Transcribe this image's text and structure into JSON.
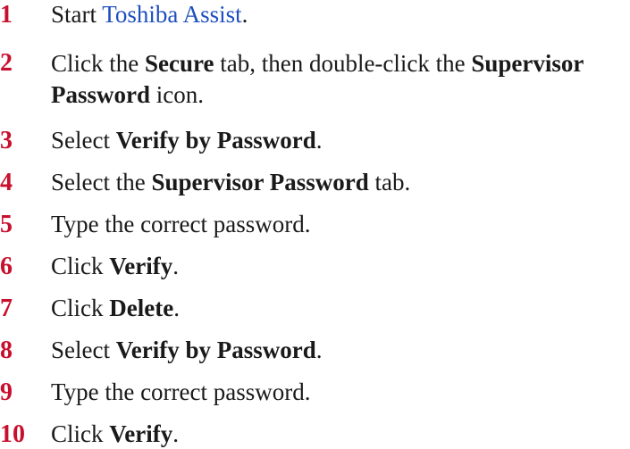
{
  "steps": [
    {
      "number": "1",
      "text_before": "Start ",
      "link": "Toshiba Assist",
      "text_after": "."
    },
    {
      "number": "2",
      "t1": "Click the ",
      "b1": "Secure",
      "t2": " tab, then double-click the ",
      "b2": "Supervisor Password",
      "t3": " icon."
    },
    {
      "number": "3",
      "t1": "Select ",
      "b1": "Verify by Password",
      "t2": "."
    },
    {
      "number": "4",
      "t1": "Select the ",
      "b1": "Supervisor Password",
      "t2": " tab."
    },
    {
      "number": "5",
      "t1": "Type the correct password."
    },
    {
      "number": "6",
      "t1": "Click ",
      "b1": "Verify",
      "t2": "."
    },
    {
      "number": "7",
      "t1": "Click ",
      "b1": "Delete",
      "t2": "."
    },
    {
      "number": "8",
      "t1": "Select ",
      "b1": "Verify by Password",
      "t2": "."
    },
    {
      "number": "9",
      "t1": "Type the correct password."
    },
    {
      "number": "10",
      "t1": "Click ",
      "b1": "Verify",
      "t2": "."
    }
  ],
  "colors": {
    "step_number": "#c8102e",
    "link": "#1f4fbf",
    "text": "#1a1a1a"
  }
}
